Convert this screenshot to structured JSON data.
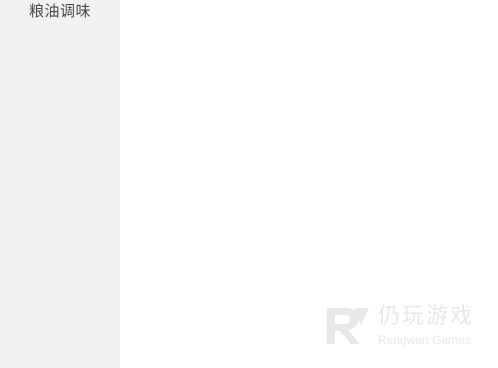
{
  "sidebar": {
    "items": [
      {
        "label": "粮油调味"
      }
    ]
  },
  "watermark": {
    "title_cn": "仍玩游戏",
    "title_en": "Rengwan Games"
  },
  "colors": {
    "sidebar_bg": "#f1f1f1",
    "main_bg": "#ffffff",
    "sidebar_text": "#4a4a4a",
    "watermark": "#e6e6e6"
  }
}
